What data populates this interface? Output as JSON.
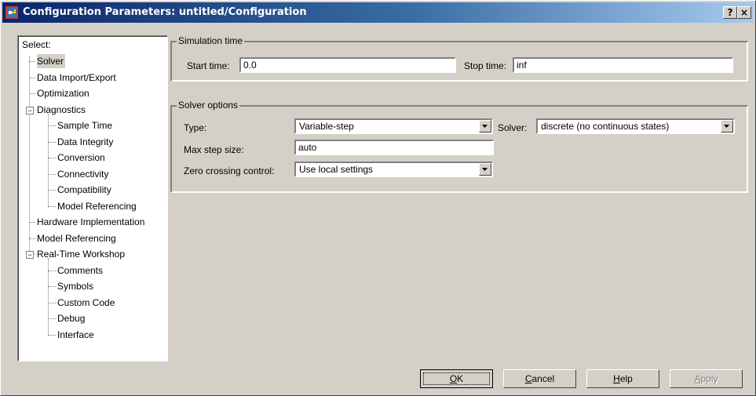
{
  "window": {
    "title": "Configuration Parameters: untitled/Configuration",
    "help_glyph": "?",
    "close_glyph": "×"
  },
  "tree": {
    "header": "Select:",
    "items": [
      {
        "label": "Solver",
        "level": 1,
        "selected": true
      },
      {
        "label": "Data Import/Export",
        "level": 1
      },
      {
        "label": "Optimization",
        "level": 1
      },
      {
        "label": "Diagnostics",
        "level": 1,
        "expander": "−"
      },
      {
        "label": "Sample Time",
        "level": 2
      },
      {
        "label": "Data Integrity",
        "level": 2
      },
      {
        "label": "Conversion",
        "level": 2
      },
      {
        "label": "Connectivity",
        "level": 2
      },
      {
        "label": "Compatibility",
        "level": 2
      },
      {
        "label": "Model Referencing",
        "level": 2
      },
      {
        "label": "Hardware Implementation",
        "level": 1
      },
      {
        "label": "Model Referencing",
        "level": 1
      },
      {
        "label": "Real-Time Workshop",
        "level": 1,
        "expander": "−"
      },
      {
        "label": "Comments",
        "level": 2
      },
      {
        "label": "Symbols",
        "level": 2
      },
      {
        "label": "Custom Code",
        "level": 2
      },
      {
        "label": "Debug",
        "level": 2
      },
      {
        "label": "Interface",
        "level": 2
      }
    ]
  },
  "simulation_time": {
    "title": "Simulation time",
    "start_label": "Start time:",
    "start_value": "0.0",
    "stop_label": "Stop time:",
    "stop_value": "inf"
  },
  "solver_options": {
    "title": "Solver options",
    "type_label": "Type:",
    "type_value": "Variable-step",
    "solver_label": "Solver:",
    "solver_value": "discrete (no continuous states)",
    "max_step_label": "Max step size:",
    "max_step_value": "auto",
    "zero_crossing_label": "Zero crossing control:",
    "zero_crossing_value": "Use local settings"
  },
  "buttons": {
    "ok": {
      "mnemonic": "O",
      "rest": "K"
    },
    "cancel": {
      "mnemonic": "C",
      "rest": "ancel"
    },
    "help": {
      "mnemonic": "H",
      "rest": "elp"
    },
    "apply": {
      "mnemonic": "A",
      "rest": "pply"
    }
  },
  "colors": {
    "titlebar_start": "#0a246a",
    "titlebar_end": "#a6caf0",
    "face": "#d4d0c8"
  }
}
